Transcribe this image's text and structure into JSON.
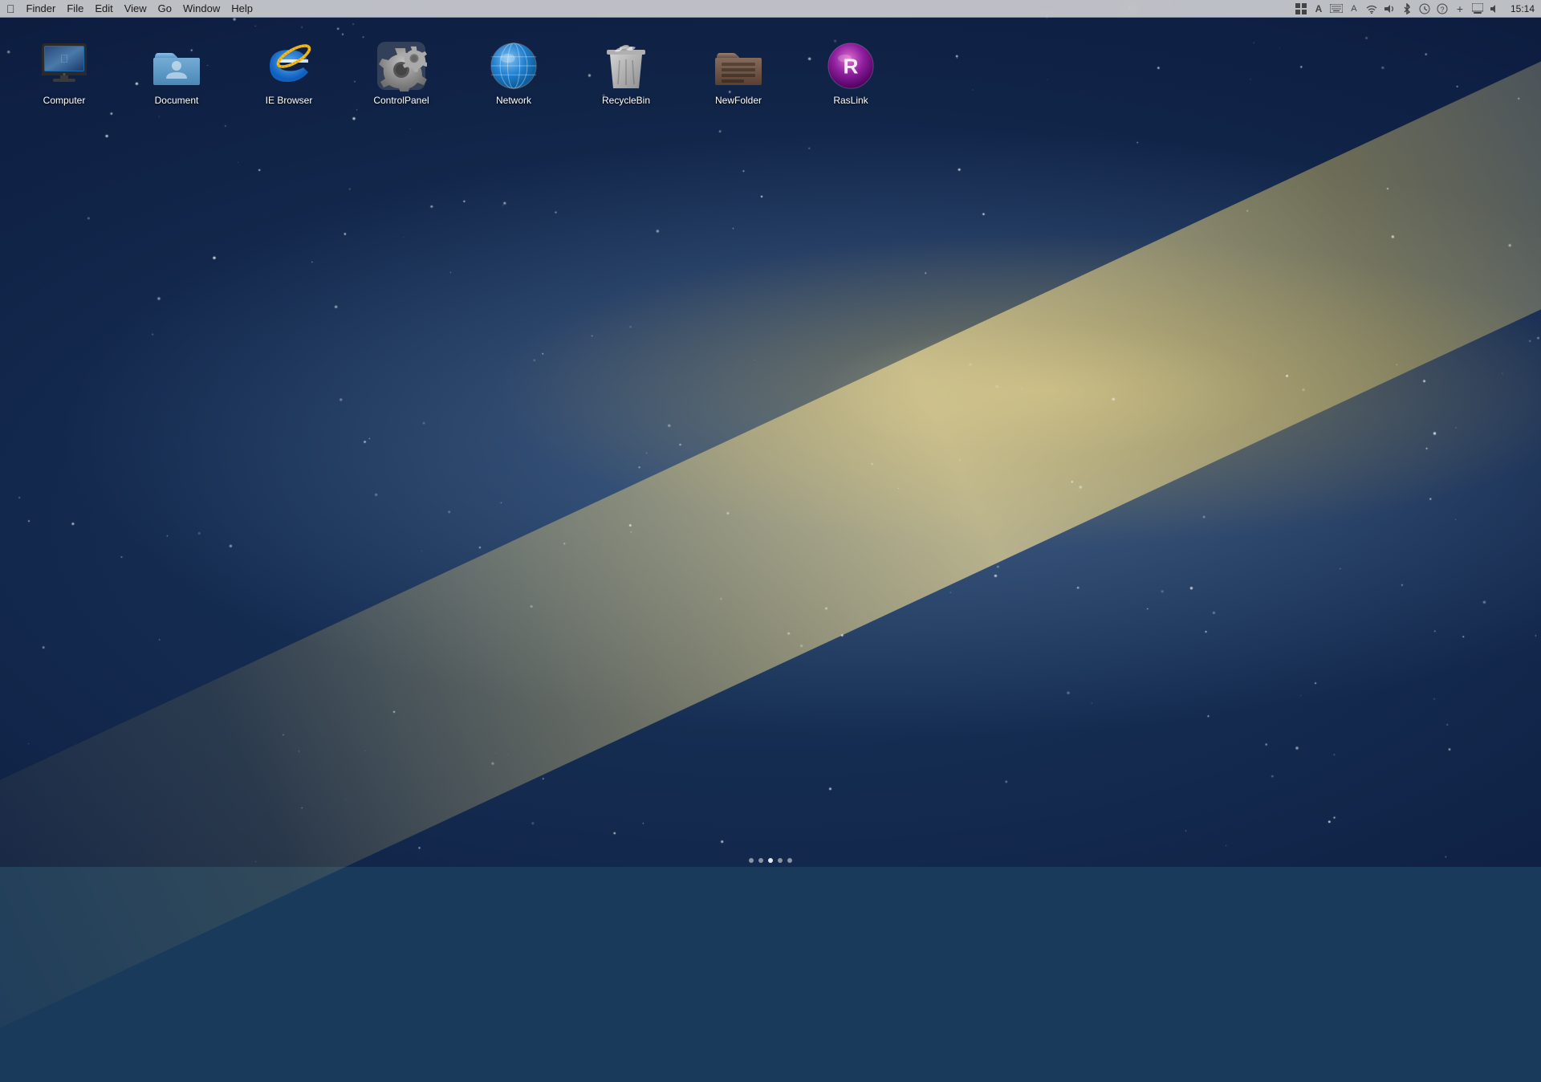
{
  "menubar": {
    "left_items": [
      "Finder",
      "File",
      "Edit",
      "View",
      "Go",
      "Window",
      "Help"
    ],
    "apple_symbol": "",
    "time": "15:14",
    "tray": {
      "icons": [
        {
          "name": "grid-icon",
          "symbol": "⊞"
        },
        {
          "name": "a-icon",
          "symbol": "A"
        },
        {
          "name": "keyboard-icon",
          "symbol": "⌨"
        },
        {
          "name": "input-icon",
          "symbol": "A"
        },
        {
          "name": "wifi-icon",
          "symbol": "◈"
        },
        {
          "name": "sound-icon",
          "symbol": "◉"
        },
        {
          "name": "bluetooth-icon",
          "symbol": "ᛒ"
        },
        {
          "name": "timemachine-icon",
          "symbol": "⊕"
        },
        {
          "name": "spotlight-icon",
          "symbol": "Q"
        },
        {
          "name": "add-icon",
          "symbol": "+"
        },
        {
          "name": "finder-icon",
          "symbol": "▦"
        },
        {
          "name": "volume-icon",
          "symbol": "◁"
        }
      ]
    }
  },
  "desktop": {
    "icons": [
      {
        "id": "computer",
        "label": "Computer",
        "type": "computer"
      },
      {
        "id": "document",
        "label": "Document",
        "type": "folder"
      },
      {
        "id": "ie-browser",
        "label": "IE Browser",
        "type": "ie"
      },
      {
        "id": "controlpanel",
        "label": "ControlPanel",
        "type": "gear"
      },
      {
        "id": "network",
        "label": "Network",
        "type": "network"
      },
      {
        "id": "recyclebin",
        "label": "RecycleBin",
        "type": "recyclebin"
      },
      {
        "id": "newfolder",
        "label": "NewFolder",
        "type": "newfolder"
      },
      {
        "id": "raslink",
        "label": "RasLink",
        "type": "raslink"
      }
    ]
  },
  "dock": {
    "dots": [
      false,
      false,
      true,
      false,
      false
    ]
  }
}
